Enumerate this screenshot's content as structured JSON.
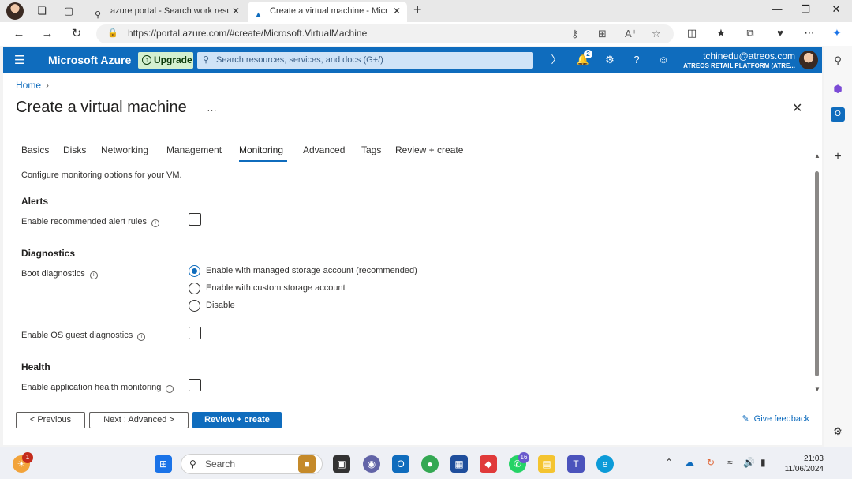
{
  "browser": {
    "tabs": [
      {
        "title": "azure portal - Search work result"
      },
      {
        "title": "Create a virtual machine - Micro"
      }
    ],
    "address": "https://portal.azure.com/#create/Microsoft.VirtualMachine"
  },
  "azure": {
    "brand": "Microsoft Azure",
    "upgrade_label": "Upgrade",
    "search_placeholder": "Search resources, services, and docs (G+/)",
    "notification_count": "2",
    "account_email": "tchinedu@atreos.com",
    "account_tenant": "ATREOS RETAIL PLATFORM (ATRE..."
  },
  "page": {
    "breadcrumb": "Home",
    "title": "Create a virtual machine",
    "ellipsis": "…",
    "tabs": [
      "Basics",
      "Disks",
      "Networking",
      "Management",
      "Monitoring",
      "Advanced",
      "Tags",
      "Review + create"
    ],
    "selected_tab": "Monitoring",
    "description": "Configure monitoring options for your VM.",
    "alerts": {
      "heading": "Alerts",
      "recommended_rules_label": "Enable recommended alert rules",
      "recommended_rules_checked": false
    },
    "diagnostics": {
      "heading": "Diagnostics",
      "boot_label": "Boot diagnostics",
      "boot_options": [
        "Enable with managed storage account (recommended)",
        "Enable with custom storage account",
        "Disable"
      ],
      "boot_selected": "Enable with managed storage account (recommended)",
      "os_guest_label": "Enable OS guest diagnostics",
      "os_guest_checked": false
    },
    "health": {
      "heading": "Health",
      "app_health_label": "Enable application health monitoring",
      "app_health_checked": false
    }
  },
  "footer": {
    "previous_label": "< Previous",
    "next_label": "Next : Advanced >",
    "review_label": "Review + create",
    "feedback_label": "Give feedback"
  },
  "taskbar": {
    "search_label": "Search",
    "time": "21:03",
    "date": "11/06/2024",
    "widget_badge": "1",
    "whatsapp_badge": "16"
  },
  "colors": {
    "azure_blue": "#0f6cbd",
    "upgrade_bg": "#d4f0d0"
  }
}
